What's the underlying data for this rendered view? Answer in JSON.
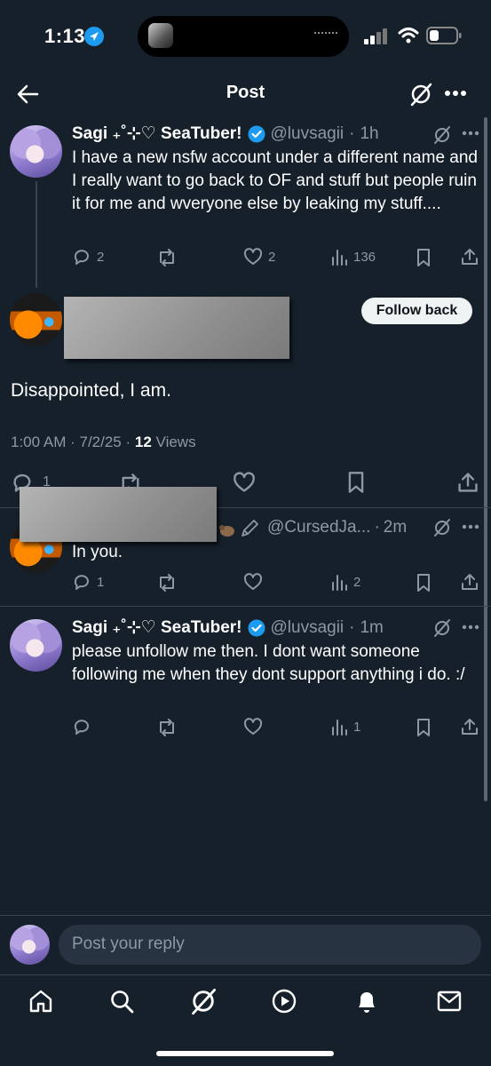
{
  "status_bar": {
    "time": "1:13"
  },
  "header": {
    "title": "Post"
  },
  "parent_post": {
    "name": "Sagi ₊˚⊹♡ SeaTuber!",
    "handle": "@luvsagii",
    "time": "1h",
    "text": "I have a new nsfw account under a different name and I really want to go back to OF and stuff but people ruin it for me and wveryone else by leaking my stuff....",
    "replies": "2",
    "likes": "2",
    "views": "136"
  },
  "main_post": {
    "follow_label": "Follow back",
    "text": "Disappointed, I am.",
    "time": "1:00 AM",
    "date": "7/2/25",
    "views_count": "12",
    "views_label": "Views",
    "replies": "1"
  },
  "reply_1": {
    "handle": "@CursedJa...",
    "time": "2m",
    "text": "In you.",
    "replies": "1",
    "views": "2"
  },
  "reply_2": {
    "name": "Sagi ₊˚⊹♡ SeaTuber!",
    "handle": "@luvsagii",
    "time": "1m",
    "text": "please unfollow me then. I dont want someone following me when they dont support anything i do. :/",
    "views": "1"
  },
  "composer": {
    "placeholder": "Post your reply"
  },
  "colors": {
    "background": "#15202b",
    "muted": "#8b98a5",
    "verified": "#1d9bf0"
  },
  "bottom_nav": [
    "home-icon",
    "search-icon",
    "grok-icon",
    "video-icon",
    "notifications-icon",
    "messages-icon"
  ]
}
